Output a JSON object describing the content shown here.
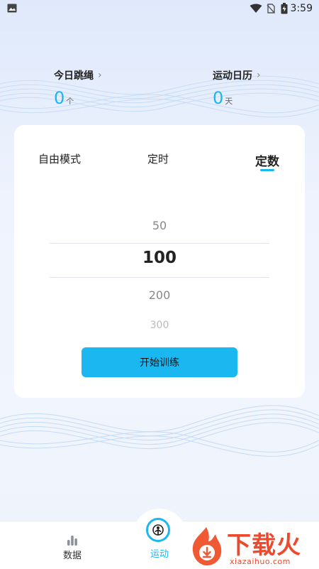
{
  "status_bar": {
    "time": "3:59",
    "icons": [
      "image-icon",
      "wifi-icon",
      "no-sim-icon",
      "battery-charging-icon"
    ]
  },
  "stats": {
    "today": {
      "title": "今日跳绳",
      "value": "0",
      "unit": "个"
    },
    "calendar": {
      "title": "运动日历",
      "value": "0",
      "unit": "天"
    }
  },
  "mode_tabs": [
    {
      "label": "自由模式",
      "active": false
    },
    {
      "label": "定时",
      "active": false
    },
    {
      "label": "定数",
      "active": true
    }
  ],
  "picker": {
    "options": [
      "50",
      "100",
      "200",
      "300"
    ],
    "selected": "100"
  },
  "start_button": {
    "label": "开始训练"
  },
  "bottom_nav": {
    "items": [
      {
        "label": "数据",
        "icon": "bar-chart-icon",
        "active": false
      },
      {
        "label": "运动",
        "icon": "person-target-icon",
        "active": true
      }
    ]
  },
  "watermark": {
    "text": "下载火",
    "url": "xiazaihuo.com"
  },
  "colors": {
    "accent": "#1ab7f0",
    "watermark": "#ec4a2e"
  }
}
